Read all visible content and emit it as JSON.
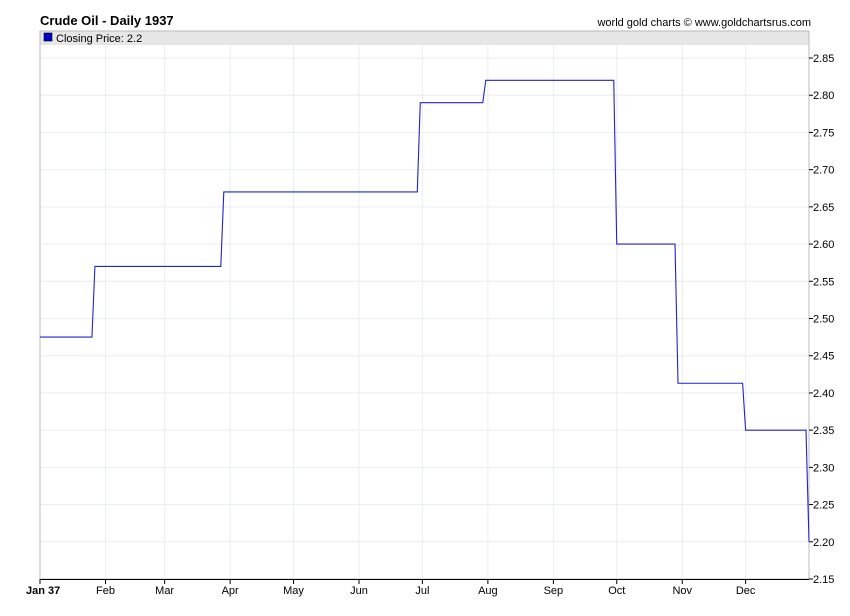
{
  "header": {
    "title": "Crude Oil - Daily 1937",
    "credit": "world gold charts © www.goldchartsrus.com"
  },
  "legend": {
    "label": "Closing Price: 2.2",
    "color": "#0000cc"
  },
  "chart_data": {
    "type": "line",
    "line_style": "step",
    "title": "Crude Oil - Daily 1937",
    "xlabel": "",
    "ylabel": "",
    "ylim": [
      2.15,
      2.88
    ],
    "xlim": [
      "1937-01-01",
      "1937-12-31"
    ],
    "grid": true,
    "legend_position": "top-left",
    "line_color": "#2222cc",
    "y_ticks": [
      "2.85",
      "2.80",
      "2.75",
      "2.70",
      "2.65",
      "2.60",
      "2.55",
      "2.50",
      "2.45",
      "2.40",
      "2.35",
      "2.30",
      "2.25",
      "2.20",
      "2.15"
    ],
    "x_ticks": [
      "Jan 37",
      "Feb",
      "Mar",
      "Apr",
      "May",
      "Jun",
      "Jul",
      "Aug",
      "Sep",
      "Oct",
      "Nov",
      "Dec"
    ],
    "series": [
      {
        "name": "Closing Price",
        "points": [
          {
            "x": "1937-01-01",
            "y": 2.475
          },
          {
            "x": "1937-01-27",
            "y": 2.57
          },
          {
            "x": "1937-03-29",
            "y": 2.67
          },
          {
            "x": "1937-06-30",
            "y": 2.79
          },
          {
            "x": "1937-07-31",
            "y": 2.82
          },
          {
            "x": "1937-10-01",
            "y": 2.6
          },
          {
            "x": "1937-10-30",
            "y": 2.413
          },
          {
            "x": "1937-12-01",
            "y": 2.35
          },
          {
            "x": "1937-12-31",
            "y": 2.2
          }
        ]
      }
    ]
  }
}
